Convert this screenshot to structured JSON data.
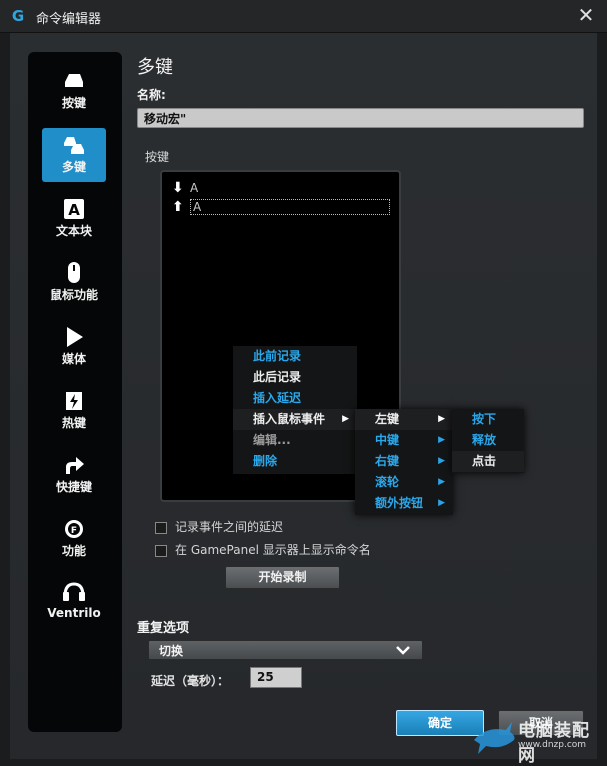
{
  "window": {
    "title": "命令编辑器",
    "logo": "G",
    "close_glyph": "✕"
  },
  "sidebar": {
    "items": [
      {
        "label": "按键",
        "icon": "key-icon"
      },
      {
        "label": "多键",
        "icon": "multi-key-icon",
        "active": true
      },
      {
        "label": "文本块",
        "icon": "text-block-icon",
        "glyph": "A"
      },
      {
        "label": "鼠标功能",
        "icon": "mouse-icon"
      },
      {
        "label": "媒体",
        "icon": "play-icon"
      },
      {
        "label": "热键",
        "icon": "hotkey-icon"
      },
      {
        "label": "快捷键",
        "icon": "shortcut-arrow-icon"
      },
      {
        "label": "功能",
        "icon": "function-gear-icon",
        "glyph": "F"
      },
      {
        "label": "Ventrilo",
        "icon": "headset-icon"
      }
    ]
  },
  "main": {
    "title": "多键",
    "name_label": "名称:",
    "name_value": "移动宏\"",
    "keys_label": "按键",
    "keys": [
      {
        "direction": "down",
        "arrow": "⬇",
        "key": "A"
      },
      {
        "direction": "up",
        "arrow": "⬆",
        "key": "A",
        "selected": true
      }
    ],
    "context_menu": [
      {
        "label": "此前记录",
        "color": "blue"
      },
      {
        "label": "此后记录",
        "color": "white"
      },
      {
        "label": "插入延迟",
        "color": "blue"
      },
      {
        "label": "插入鼠标事件",
        "color": "white",
        "submenu": true,
        "highlight": true
      },
      {
        "label": "编辑...",
        "color": "gray"
      },
      {
        "label": "删除",
        "color": "blue"
      }
    ],
    "mouse_submenu": [
      {
        "label": "左键",
        "color": "white",
        "submenu": true,
        "highlight": true
      },
      {
        "label": "中键",
        "color": "blue",
        "submenu": true
      },
      {
        "label": "右键",
        "color": "blue",
        "submenu": true
      },
      {
        "label": "滚轮",
        "color": "blue",
        "submenu": true
      },
      {
        "label": "额外按钮",
        "color": "blue",
        "submenu": true
      }
    ],
    "left_button_submenu": [
      {
        "label": "按下",
        "color": "blue"
      },
      {
        "label": "释放",
        "color": "blue"
      },
      {
        "label": "点击",
        "color": "white"
      }
    ],
    "submenu_arrow": "▶",
    "checkbox_delay": "记录事件之间的延迟",
    "checkbox_gamepanel": "在 GamePanel 显示器上显示命令名",
    "record_button": "开始录制",
    "repeat_label": "重复选项",
    "repeat_value": "切换",
    "repeat_chevron": "⌄",
    "delay_label": "延迟（毫秒）：",
    "delay_value": "25",
    "ok_button": "确定",
    "cancel_button": "取消"
  },
  "watermark": {
    "title": "电脑装配网",
    "url": "www.dnzp.com"
  },
  "colors": {
    "accent": "#1f8ec9",
    "menu_blue": "#2aa8ec",
    "background": "#2b2e31"
  }
}
